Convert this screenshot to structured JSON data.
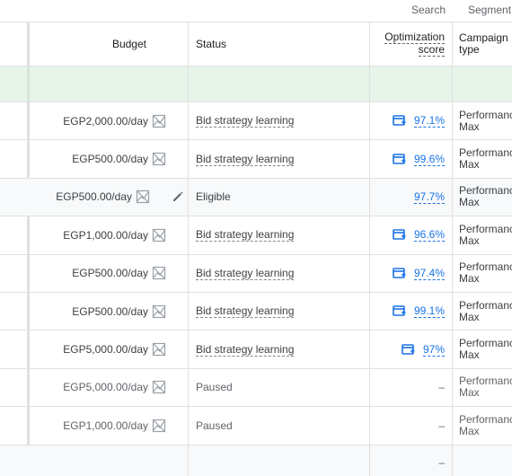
{
  "toolbar": {
    "search_label": "Search",
    "segment_label": "Segment"
  },
  "columns": {
    "budget": "Budget",
    "status": "Status",
    "opt_line1": "Optimization",
    "opt_line2": "score",
    "type_line1": "Campaign",
    "type_line2": "type"
  },
  "rows": [
    {
      "budget": "EGP2,000.00/day",
      "status": "Bid strategy learning",
      "opt": "97.1%",
      "type1": "Performance",
      "type2": "Max"
    },
    {
      "budget": "EGP500.00/day",
      "status": "Bid strategy learning",
      "opt": "99.6%",
      "type1": "Performance",
      "type2": "Max"
    },
    {
      "budget": "EGP500.00/day",
      "status": "Eligible",
      "opt": "97.7%",
      "type1": "Performance",
      "type2": "Max"
    },
    {
      "budget": "EGP1,000.00/day",
      "status": "Bid strategy learning",
      "opt": "96.6%",
      "type1": "Performance",
      "type2": "Max"
    },
    {
      "budget": "EGP500.00/day",
      "status": "Bid strategy learning",
      "opt": "97.4%",
      "type1": "Performance",
      "type2": "Max"
    },
    {
      "budget": "EGP500.00/day",
      "status": "Bid strategy learning",
      "opt": "99.1%",
      "type1": "Performance",
      "type2": "Max"
    },
    {
      "budget": "EGP5,000.00/day",
      "status": "Bid strategy learning",
      "opt": "97%",
      "type1": "Performance",
      "type2": "Max"
    },
    {
      "budget": "EGP5,000.00/day",
      "status": "Paused",
      "opt": "–",
      "type1": "Performance",
      "type2": "Max"
    },
    {
      "budget": "EGP1,000.00/day",
      "status": "Paused",
      "opt": "–",
      "type1": "Performance",
      "type2": "Max"
    }
  ],
  "footer": {
    "opt": "–"
  },
  "icons": {
    "budget_chart": "budget-report-chart-icon",
    "edit": "pencil-icon",
    "recommendation": "apply-recommendation-icon"
  },
  "colors": {
    "accent": "#1a73e8",
    "total_row": "#e6f4ea"
  }
}
